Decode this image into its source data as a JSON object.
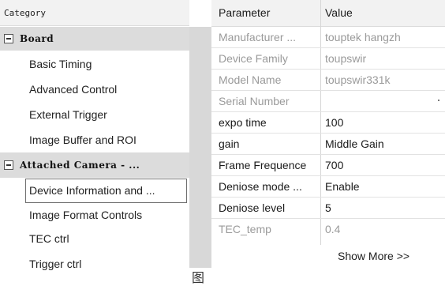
{
  "tree": {
    "header": "Category",
    "groups": [
      {
        "label": "Board",
        "items": [
          "Basic Timing",
          "Advanced Control",
          "External Trigger",
          "Image Buffer and ROI"
        ]
      },
      {
        "label": "Attached Camera - ...",
        "items": [
          "Device Information and ...",
          "Image Format Controls",
          "TEC ctrl",
          "Trigger ctrl"
        ]
      }
    ]
  },
  "grid": {
    "header": {
      "parameter": "Parameter",
      "value": "Value"
    },
    "rows": [
      {
        "name": "Manufacturer ...",
        "value": "touptek hangzh",
        "readonly": true
      },
      {
        "name": "Device Family",
        "value": "toupswir",
        "readonly": true
      },
      {
        "name": "Model Name",
        "value": "toupswir331k",
        "readonly": true
      },
      {
        "name": "Serial Number",
        "value": "",
        "readonly": true
      },
      {
        "name": "expo time",
        "value": "100",
        "readonly": false
      },
      {
        "name": "gain",
        "value": "Middle Gain",
        "readonly": false
      },
      {
        "name": "Frame Frequence",
        "value": "700",
        "readonly": false
      },
      {
        "name": "Deniose mode ...",
        "value": "Enable",
        "readonly": false
      },
      {
        "name": "Deniose level",
        "value": "5",
        "readonly": false
      },
      {
        "name": "TEC_temp",
        "value": "0.4",
        "readonly": true
      }
    ],
    "show_more": "Show More >>"
  },
  "caption_glyph": "图"
}
